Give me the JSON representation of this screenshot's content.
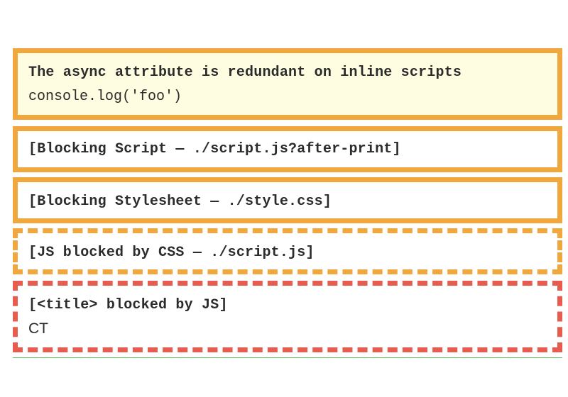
{
  "colors": {
    "warning_orange": "#f0a73e",
    "blocking_red": "#e85c50",
    "cream_highlight": "#fffde1",
    "divider_green": "#6cc96e",
    "text": "#2b2b2b"
  },
  "items": [
    {
      "heading": "The async attribute is redundant on inline scripts",
      "body": "console.log('foo')",
      "style": "solid-orange-highlighted"
    },
    {
      "heading": "[Blocking Script — ./script.js?after-print]",
      "style": "solid-orange"
    },
    {
      "heading": "[Blocking Stylesheet — ./style.css]",
      "style": "solid-orange"
    },
    {
      "heading": "[JS blocked by CSS — ./script.js]",
      "style": "dashed-orange"
    },
    {
      "heading": "[<title> blocked by JS]",
      "body": "CT",
      "style": "dashed-red"
    }
  ]
}
